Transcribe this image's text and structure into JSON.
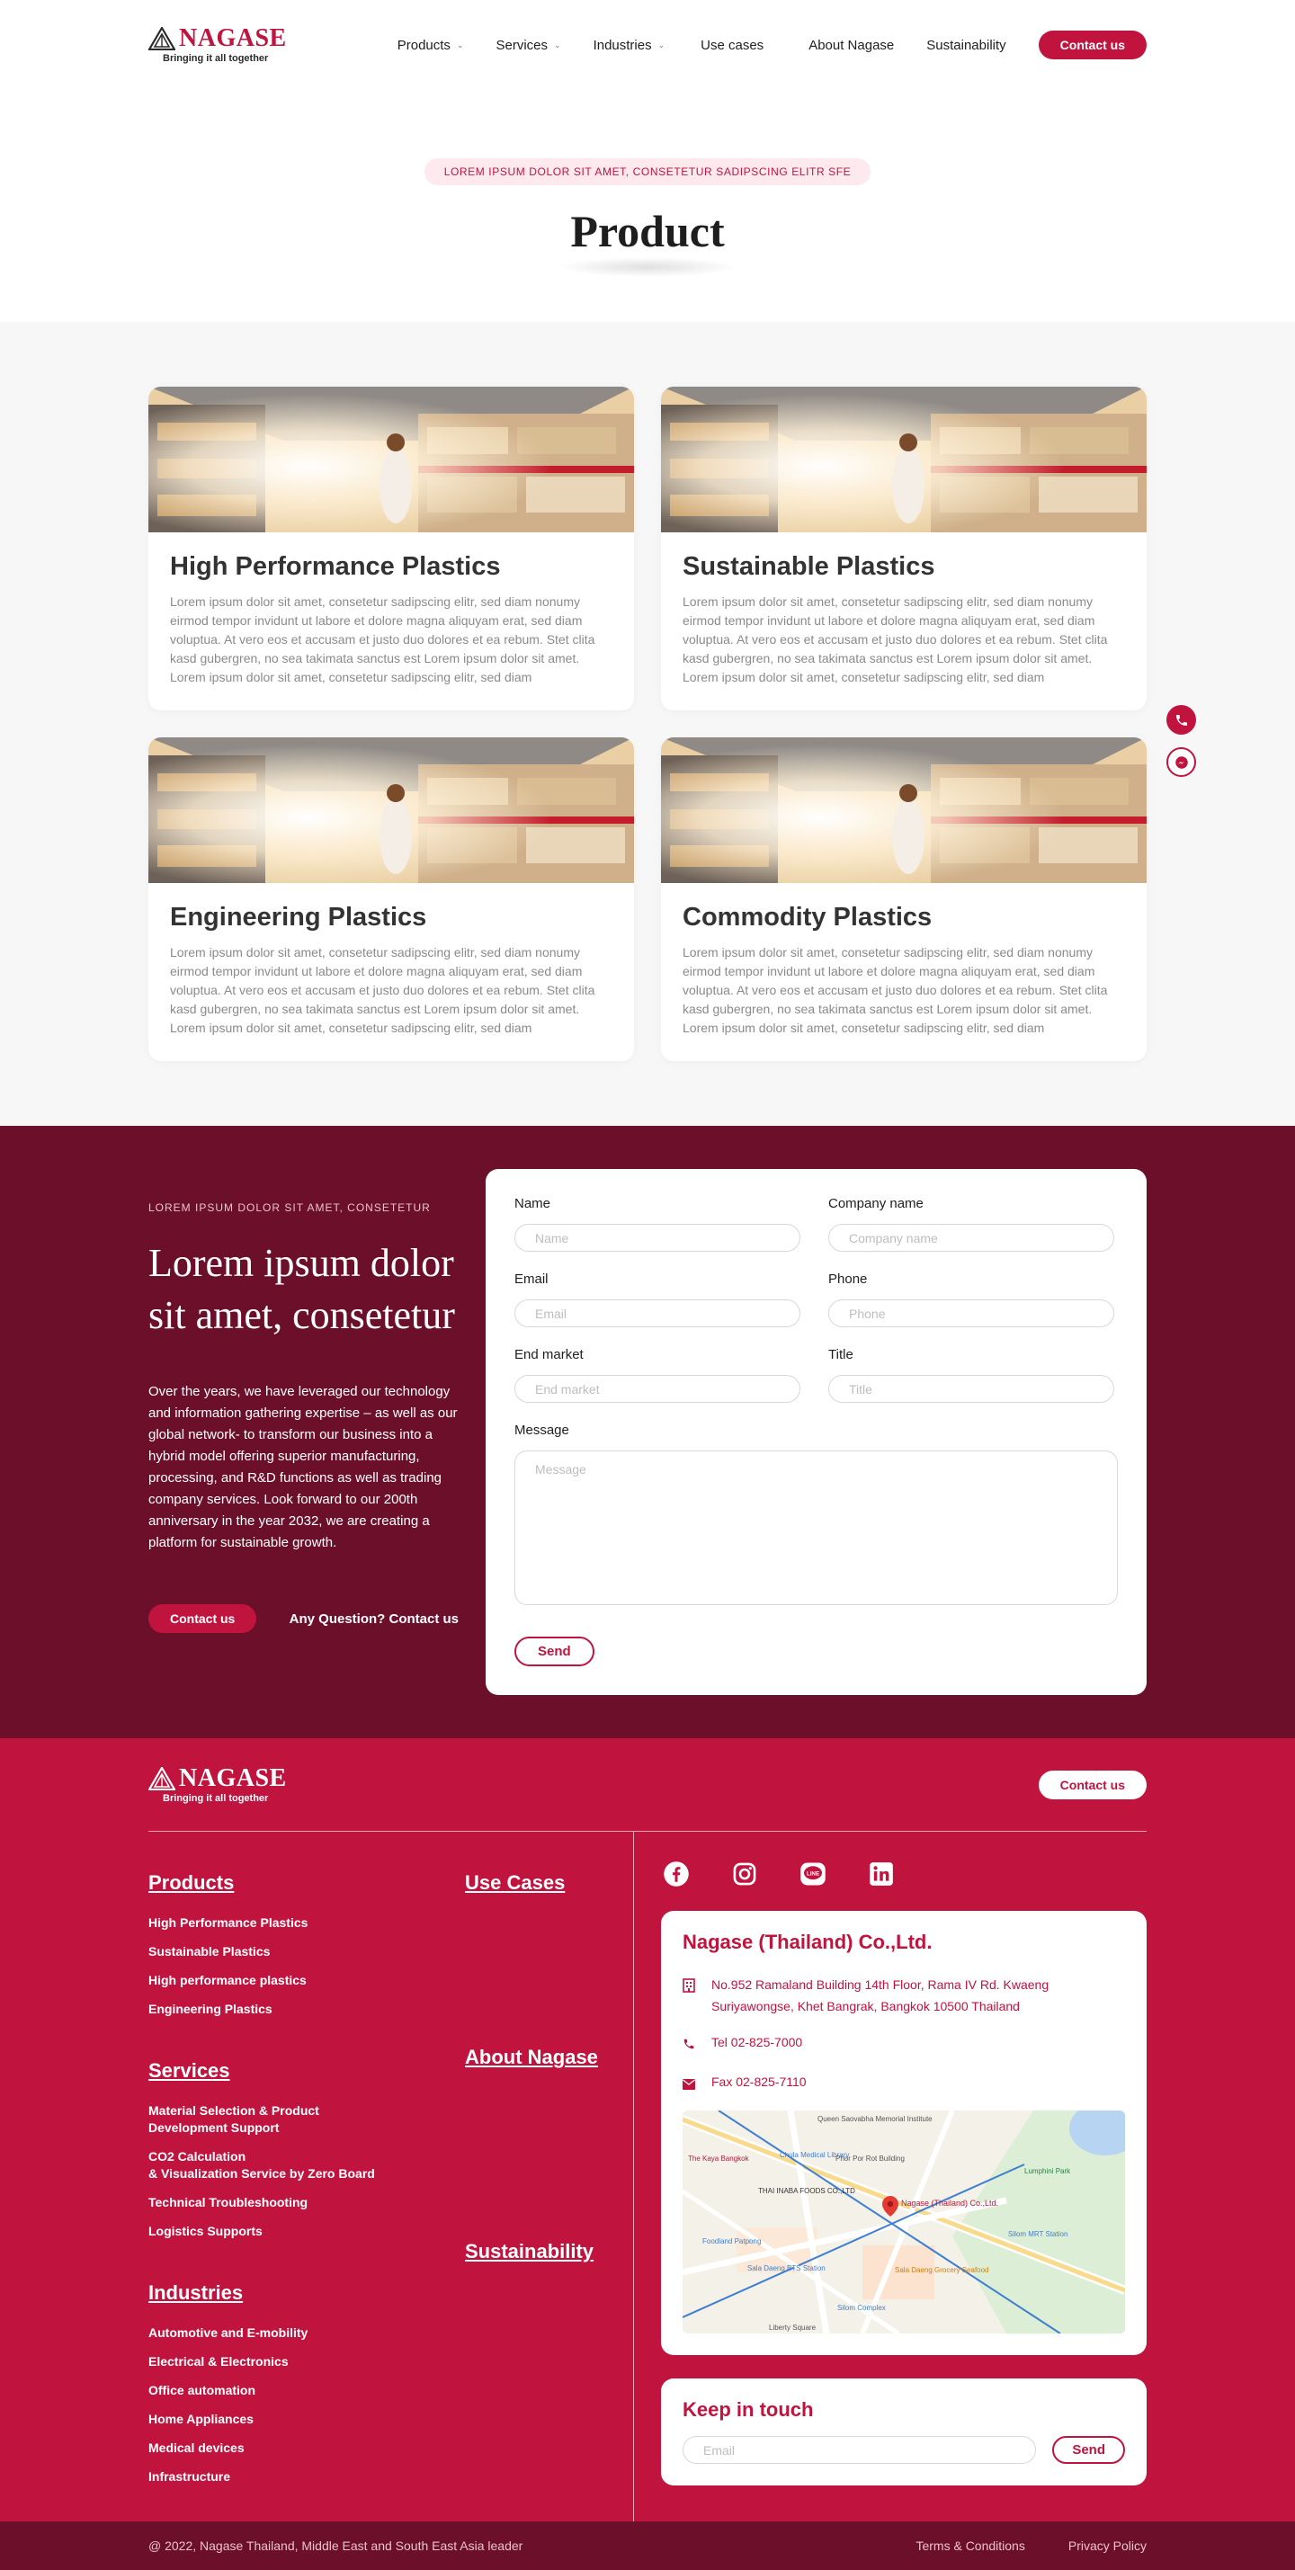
{
  "header": {
    "logo_word": "NAGASE",
    "logo_tagline": "Bringing it all together",
    "nav": [
      {
        "label": "Products",
        "dropdown": true
      },
      {
        "label": "Services",
        "dropdown": true
      },
      {
        "label": "Industries",
        "dropdown": true
      },
      {
        "label": "Use cases",
        "dropdown": false
      },
      {
        "label": "About Nagase",
        "dropdown": false
      },
      {
        "label": "Sustainability",
        "dropdown": false
      }
    ],
    "contact_label": "Contact us",
    "chevron": "⌄"
  },
  "hero": {
    "tag": "LOREM IPSUM DOLOR SIT AMET, CONSETETUR  SADIPSCING ELITR SFE",
    "title": "Product"
  },
  "products": [
    {
      "title": "High Performance Plastics",
      "text": "Lorem ipsum dolor sit amet, consetetur sadipscing elitr, sed diam nonumy eirmod tempor invidunt ut labore et dolore magna aliquyam erat, sed diam voluptua. At vero eos et accusam et justo duo dolores et ea rebum. Stet clita kasd gubergren, no sea takimata sanctus est Lorem ipsum dolor sit amet. Lorem ipsum dolor sit amet, consetetur sadipscing elitr, sed diam"
    },
    {
      "title": "Sustainable Plastics",
      "text": "Lorem ipsum dolor sit amet, consetetur sadipscing elitr, sed diam nonumy eirmod tempor invidunt ut labore et dolore magna aliquyam erat, sed diam voluptua. At vero eos et accusam et justo duo dolores et ea rebum. Stet clita kasd gubergren, no sea takimata sanctus est Lorem ipsum dolor sit amet. Lorem ipsum dolor sit amet, consetetur sadipscing elitr, sed diam"
    },
    {
      "title": "Engineering Plastics",
      "text": "Lorem ipsum dolor sit amet, consetetur sadipscing elitr, sed diam nonumy eirmod tempor invidunt ut labore et dolore magna aliquyam erat, sed diam voluptua. At vero eos et accusam et justo duo dolores et ea rebum. Stet clita kasd gubergren, no sea takimata sanctus est Lorem ipsum dolor sit amet. Lorem ipsum dolor sit amet, consetetur sadipscing elitr, sed diam"
    },
    {
      "title": "Commodity Plastics",
      "text": "Lorem ipsum dolor sit amet, consetetur sadipscing elitr, sed diam nonumy eirmod tempor invidunt ut labore et dolore magna aliquyam erat, sed diam voluptua. At vero eos et accusam et justo duo dolores et ea rebum. Stet clita kasd gubergren, no sea takimata sanctus est Lorem ipsum dolor sit amet. Lorem ipsum dolor sit amet, consetetur sadipscing elitr, sed diam"
    }
  ],
  "contact": {
    "kicker": "LOREM IPSUM DOLOR SIT AMET, CONSETETUR",
    "heading": "Lorem ipsum dolor sit amet, consetetur",
    "body": "Over the years, we have leveraged our technology and information gathering expertise – as well as our global network- to transform our business into a hybrid model offering superior manufacturing, processing, and R&D functions as well as trading company services. Look forward to our 200th anniversary in the year 2032, we are creating a platform for sustainable growth.",
    "contact_label": "Contact us",
    "question_label": "Any Question? Contact us",
    "form": {
      "name_label": "Name",
      "name_placeholder": "Name",
      "company_label": "Company name",
      "company_placeholder": "Company name",
      "email_label": "Email",
      "email_placeholder": "Email",
      "phone_label": "Phone",
      "phone_placeholder": "Phone",
      "market_label": "End market",
      "market_placeholder": "End market",
      "title_label": "Title",
      "title_placeholder": "Title",
      "message_label": "Message",
      "message_placeholder": "Message",
      "send_label": "Send"
    }
  },
  "footer": {
    "logo_word": "NAGASE",
    "logo_tagline": "Bringing it all together",
    "contact_label": "Contact us",
    "products": {
      "heading": "Products",
      "items": [
        "High Performance Plastics",
        "Sustainable Plastics",
        "High performance plastics",
        "Engineering Plastics"
      ]
    },
    "use_cases": {
      "heading": "Use Cases"
    },
    "services": {
      "heading": "Services",
      "items": [
        "Material Selection & Product\nDevelopment Support",
        "CO2 Calculation\n& Visualization Service by Zero Board",
        "Technical Troubleshooting",
        "Logistics Supports"
      ]
    },
    "about": {
      "heading": "About Nagase"
    },
    "industries": {
      "heading": "Industries",
      "items": [
        "Automotive and E-mobility",
        "Electrical & Electronics",
        "Office automation",
        "Home Appliances",
        "Medical devices",
        "Infrastructure"
      ]
    },
    "sustainability": {
      "heading": "Sustainability"
    },
    "socials": [
      "facebook-icon",
      "instagram-icon",
      "line-icon",
      "linkedin-icon"
    ],
    "company": {
      "name": "Nagase (Thailand) Co.,Ltd.",
      "address": "No.952 Ramaland Building 14th Floor, Rama IV Rd. Kwaeng Suriyawongse, Khet Bangrak, Bangkok 10500 Thailand",
      "tel": "Tel 02-825-7000",
      "fax": "Fax 02-825-7110"
    },
    "map_labels": {
      "a": "Phor Por Rot Building",
      "b": "THAI INABA FOODS CO.,LTD",
      "c": "Nagase (Thailand) Co.,Ltd.",
      "d": "Foodland Patpong",
      "e": "Sala Daeng BTS Station",
      "f": "Silom Complex",
      "g": "Silom MRT Station",
      "h": "Chula Medical Library",
      "i": "The Kaya Bangkok",
      "j": "Sala Daeng Grocery Seafood",
      "k": "Lumphini Park",
      "l": "Liberty Square",
      "m": "Queen Saovabha Memorial Institute"
    },
    "keep": {
      "heading": "Keep in touch",
      "placeholder": "Email",
      "send_label": "Send"
    },
    "copyright": "@ 2022, Nagase Thailand, Middle East and  South East Asia leader",
    "terms": "Terms & Conditions",
    "privacy": "Privacy Policy"
  },
  "colors": {
    "brand": "#c0143f",
    "dark": "#6c0f2b",
    "bg_grey": "#f7f7f7"
  }
}
